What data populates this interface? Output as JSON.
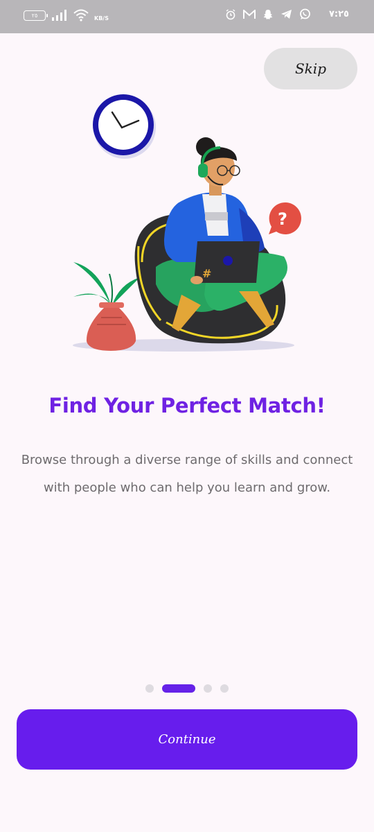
{
  "status_bar": {
    "battery_level": "٢٥",
    "network_speed": "KB/S",
    "time": "٧:٢٥",
    "left_icons": [
      "battery-icon",
      "signal-icon",
      "wifi-icon"
    ],
    "right_icons": [
      "alarm-icon",
      "gmail-icon",
      "snapchat-icon",
      "telegram-icon",
      "whatsapp-icon"
    ]
  },
  "onboarding": {
    "skip_label": "Skip",
    "title": "Find Your Perfect Match!",
    "description": "Browse through a diverse range of skills and connect with people who can help you learn and grow.",
    "page_index": 2,
    "page_count": 4,
    "continue_label": "Continue"
  },
  "colors": {
    "background": "#fdf7fb",
    "title": "#6f22e3",
    "accent": "#671ded",
    "skip_button": "#e2e1e2",
    "status_bar": "#b8b6b9"
  }
}
